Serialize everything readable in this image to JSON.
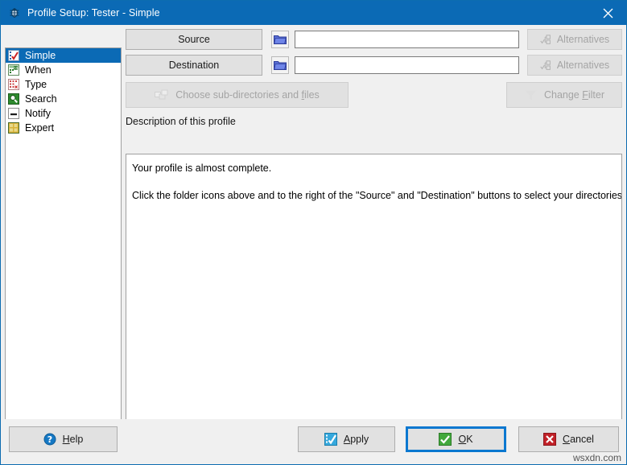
{
  "window": {
    "title": "Profile Setup: Tester - Simple",
    "title_icon": "bug-icon",
    "close_icon": "close-icon",
    "accent_color": "#0b6ab5",
    "face_color": "#f0f0f0"
  },
  "sidebar": {
    "items": [
      {
        "label": "Simple",
        "icon": "simple-icon",
        "selected": true
      },
      {
        "label": "When",
        "icon": "calendar-icon",
        "selected": false
      },
      {
        "label": "Type",
        "icon": "type-grid-icon",
        "selected": false
      },
      {
        "label": "Search",
        "icon": "magnifier-icon",
        "selected": false
      },
      {
        "label": "Notify",
        "icon": "notify-icon",
        "selected": false
      },
      {
        "label": "Expert",
        "icon": "expert-grid-icon",
        "selected": false
      }
    ]
  },
  "main": {
    "source": {
      "button_label": "Source",
      "folder_icon": "folder-icon",
      "path_value": "",
      "alternatives_label": "Alternatives",
      "alternatives_icon": "alternatives-icon",
      "alternatives_disabled": true
    },
    "destination": {
      "button_label": "Destination",
      "folder_icon": "folder-icon",
      "path_value": "",
      "alternatives_label": "Alternatives",
      "alternatives_icon": "alternatives-icon",
      "alternatives_disabled": true
    },
    "choose_button": {
      "label_prefix": "Choose sub-directories and ",
      "label_accel": "f",
      "label_suffix": "iles",
      "icon": "folders-icon",
      "disabled": true
    },
    "filter_button": {
      "label_prefix": "Change ",
      "label_accel": "F",
      "label_suffix": "ilter",
      "icon": "funnel-icon",
      "disabled": true
    },
    "description": {
      "label": "Description of this profile",
      "lines": [
        "Your profile is almost complete.",
        "Click the folder icons above and to the right of the \"Source\" and \"Destination\" buttons to select your directories."
      ]
    }
  },
  "footer": {
    "help": {
      "prefix": "",
      "accel": "H",
      "suffix": "elp",
      "icon": "help-icon"
    },
    "apply": {
      "prefix": "",
      "accel": "A",
      "suffix": "pply",
      "icon": "apply-icon"
    },
    "ok": {
      "prefix": "",
      "accel": "O",
      "suffix": "K",
      "icon": "ok-check-icon",
      "focused": true
    },
    "cancel": {
      "prefix": "",
      "accel": "C",
      "suffix": "ancel",
      "icon": "cancel-x-icon"
    }
  },
  "watermark": {
    "text": "wsxdn.com"
  }
}
